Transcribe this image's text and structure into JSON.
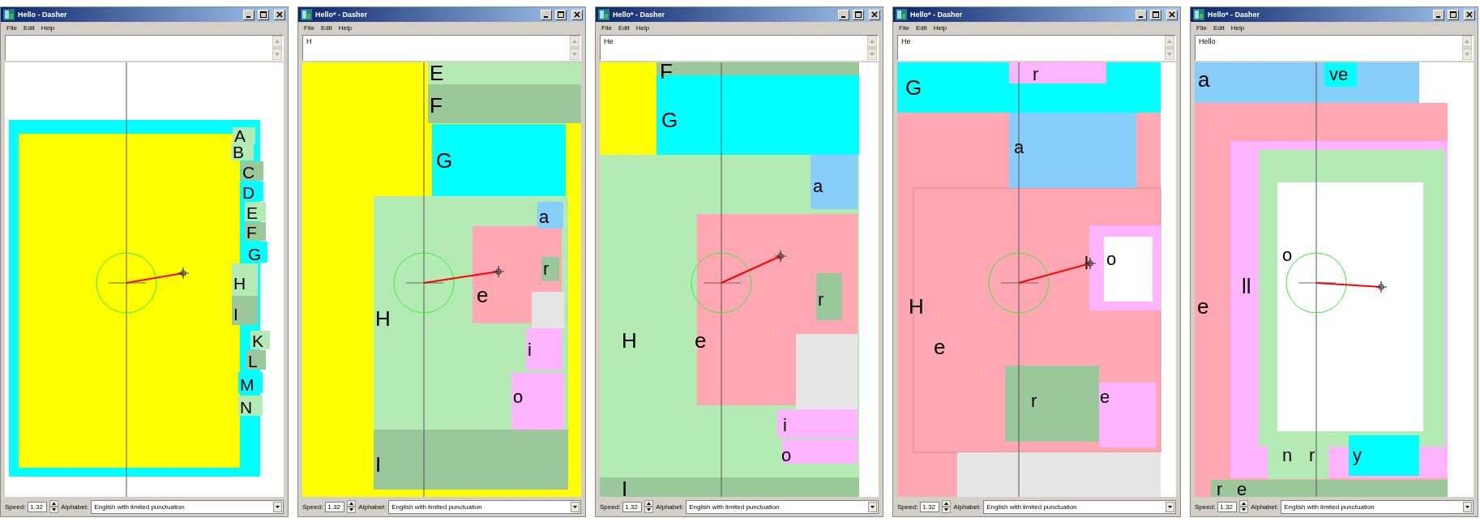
{
  "windows": [
    {
      "title": "Hello - Dasher",
      "menu": [
        "File",
        "Edit",
        "Help"
      ],
      "speed_label": "Speed:",
      "speed": "1.32",
      "alphabet_label": "Alphabet:",
      "alphabet": "English with limited punctuation",
      "canvas": {
        "nodes": [
          {
            "color": "#00ffff"
          },
          {
            "color": "#ffff00"
          },
          {
            "label": "A",
            "color": "#b4ebb4"
          },
          {
            "label": "B",
            "color": "#b4ebb4"
          },
          {
            "label": "C",
            "color": "#9bc89b"
          },
          {
            "label": "D",
            "color": "#00ffff"
          },
          {
            "label": "E",
            "color": "#b4ebb4"
          },
          {
            "label": "F",
            "color": "#9bc89b"
          },
          {
            "label": "G",
            "color": "#00ffff"
          },
          {
            "label": "H",
            "color": "#b4ebb4"
          },
          {
            "label": "I",
            "color": "#9bc89b"
          },
          {
            "label": "K",
            "color": "#b4ebb4"
          },
          {
            "label": "L",
            "color": "#9bc89b"
          },
          {
            "label": "M",
            "color": "#00ffff"
          },
          {
            "label": "N",
            "color": "#b4ebb4"
          }
        ]
      }
    },
    {
      "title": "Hello* - Dasher",
      "menu": [
        "File",
        "Edit",
        "Help"
      ],
      "text": "H",
      "speed_label": "Speed:",
      "speed": "1.32",
      "alphabet_label": "Alphabet:",
      "alphabet": "English with limited punctuation",
      "canvas": {
        "nodes": [
          {
            "color": "#ffff00"
          },
          {
            "label": "E",
            "color": "#b4ebb4"
          },
          {
            "label": "F",
            "color": "#9bc89b"
          },
          {
            "label": "G",
            "color": "#00ffff"
          },
          {
            "label": "H",
            "color": "#b4ebb4"
          },
          {
            "label": "e",
            "color": "#ffa8b4"
          },
          {
            "label": "a",
            "color": "#87cefa"
          },
          {
            "label": "r",
            "color": "#9bc89b"
          },
          {
            "color": "#e6e6e6"
          },
          {
            "label": "i",
            "color": "#ffb4ff"
          },
          {
            "label": "o",
            "color": "#ffb4ff"
          },
          {
            "label": "I",
            "color": "#9bc89b"
          }
        ]
      }
    },
    {
      "title": "Hello* - Dasher",
      "menu": [
        "File",
        "Edit",
        "Help"
      ],
      "text": "He",
      "speed_label": "Speed:",
      "speed": "1.32",
      "alphabet_label": "Alphabet:",
      "alphabet": "English with limited punctuation",
      "canvas": {
        "nodes": [
          {
            "color": "#ffff00"
          },
          {
            "label": "F",
            "color": "#9bc89b"
          },
          {
            "label": "G",
            "color": "#00ffff"
          },
          {
            "label": "H",
            "color": "#b4ebb4"
          },
          {
            "label": "e",
            "color": "#ffa8b4"
          },
          {
            "label": "a",
            "color": "#87cefa"
          },
          {
            "label": "r",
            "color": "#9bc89b"
          },
          {
            "color": "#e6e6e6"
          },
          {
            "label": "i",
            "color": "#ffb4ff"
          },
          {
            "label": "o",
            "color": "#ffb4ff"
          },
          {
            "label": "I",
            "color": "#9bc89b"
          }
        ]
      }
    },
    {
      "title": "Hello* - Dasher",
      "menu": [
        "File",
        "Edit",
        "Help"
      ],
      "text": "He",
      "speed_label": "Speed:",
      "speed": "1.32",
      "alphabet_label": "Alphabet:",
      "alphabet": "English with limited punctuation",
      "canvas": {
        "nodes": [
          {
            "label": "G",
            "color": "#00ffff"
          },
          {
            "label": "H",
            "color": "#ffa8b4"
          },
          {
            "label": "e",
            "color": "#ffa8b4"
          },
          {
            "label": "a",
            "color": "#87cefa"
          },
          {
            "label": "l",
            "color": "#ffb4ff"
          },
          {
            "label": "o",
            "color": "#ffffff"
          },
          {
            "label": "r",
            "color": "#9bc89b"
          },
          {
            "label": "e",
            "color": "#ffb4ff"
          },
          {
            "color": "#e6e6e6"
          },
          {
            "label": "r",
            "color": "#ffb4ff"
          }
        ]
      }
    },
    {
      "title": "Hello* - Dasher",
      "menu": [
        "File",
        "Edit",
        "Help"
      ],
      "text": "Hello",
      "speed_label": "Speed:",
      "speed": "1.32",
      "alphabet_label": "Alphabet:",
      "alphabet": "English with limited punctuation",
      "canvas": {
        "nodes": [
          {
            "label": "a",
            "color": "#87cefa"
          },
          {
            "label": "e",
            "color": "#ffa8b4"
          },
          {
            "label": "ll",
            "color": "#ffb4ff"
          },
          {
            "color": "#b4ebb4"
          },
          {
            "label": "o",
            "color": "#ffffff"
          },
          {
            "label": "n",
            "color": "#b4ebb4"
          },
          {
            "label": "r",
            "color": "#b4ebb4"
          },
          {
            "label": "y",
            "color": "#00ffff"
          },
          {
            "label": "r",
            "color": "#9bc89b"
          },
          {
            "label": "e",
            "color": "#9bc89b"
          },
          {
            "label": "ve",
            "color": "#00ffff"
          }
        ]
      }
    }
  ]
}
